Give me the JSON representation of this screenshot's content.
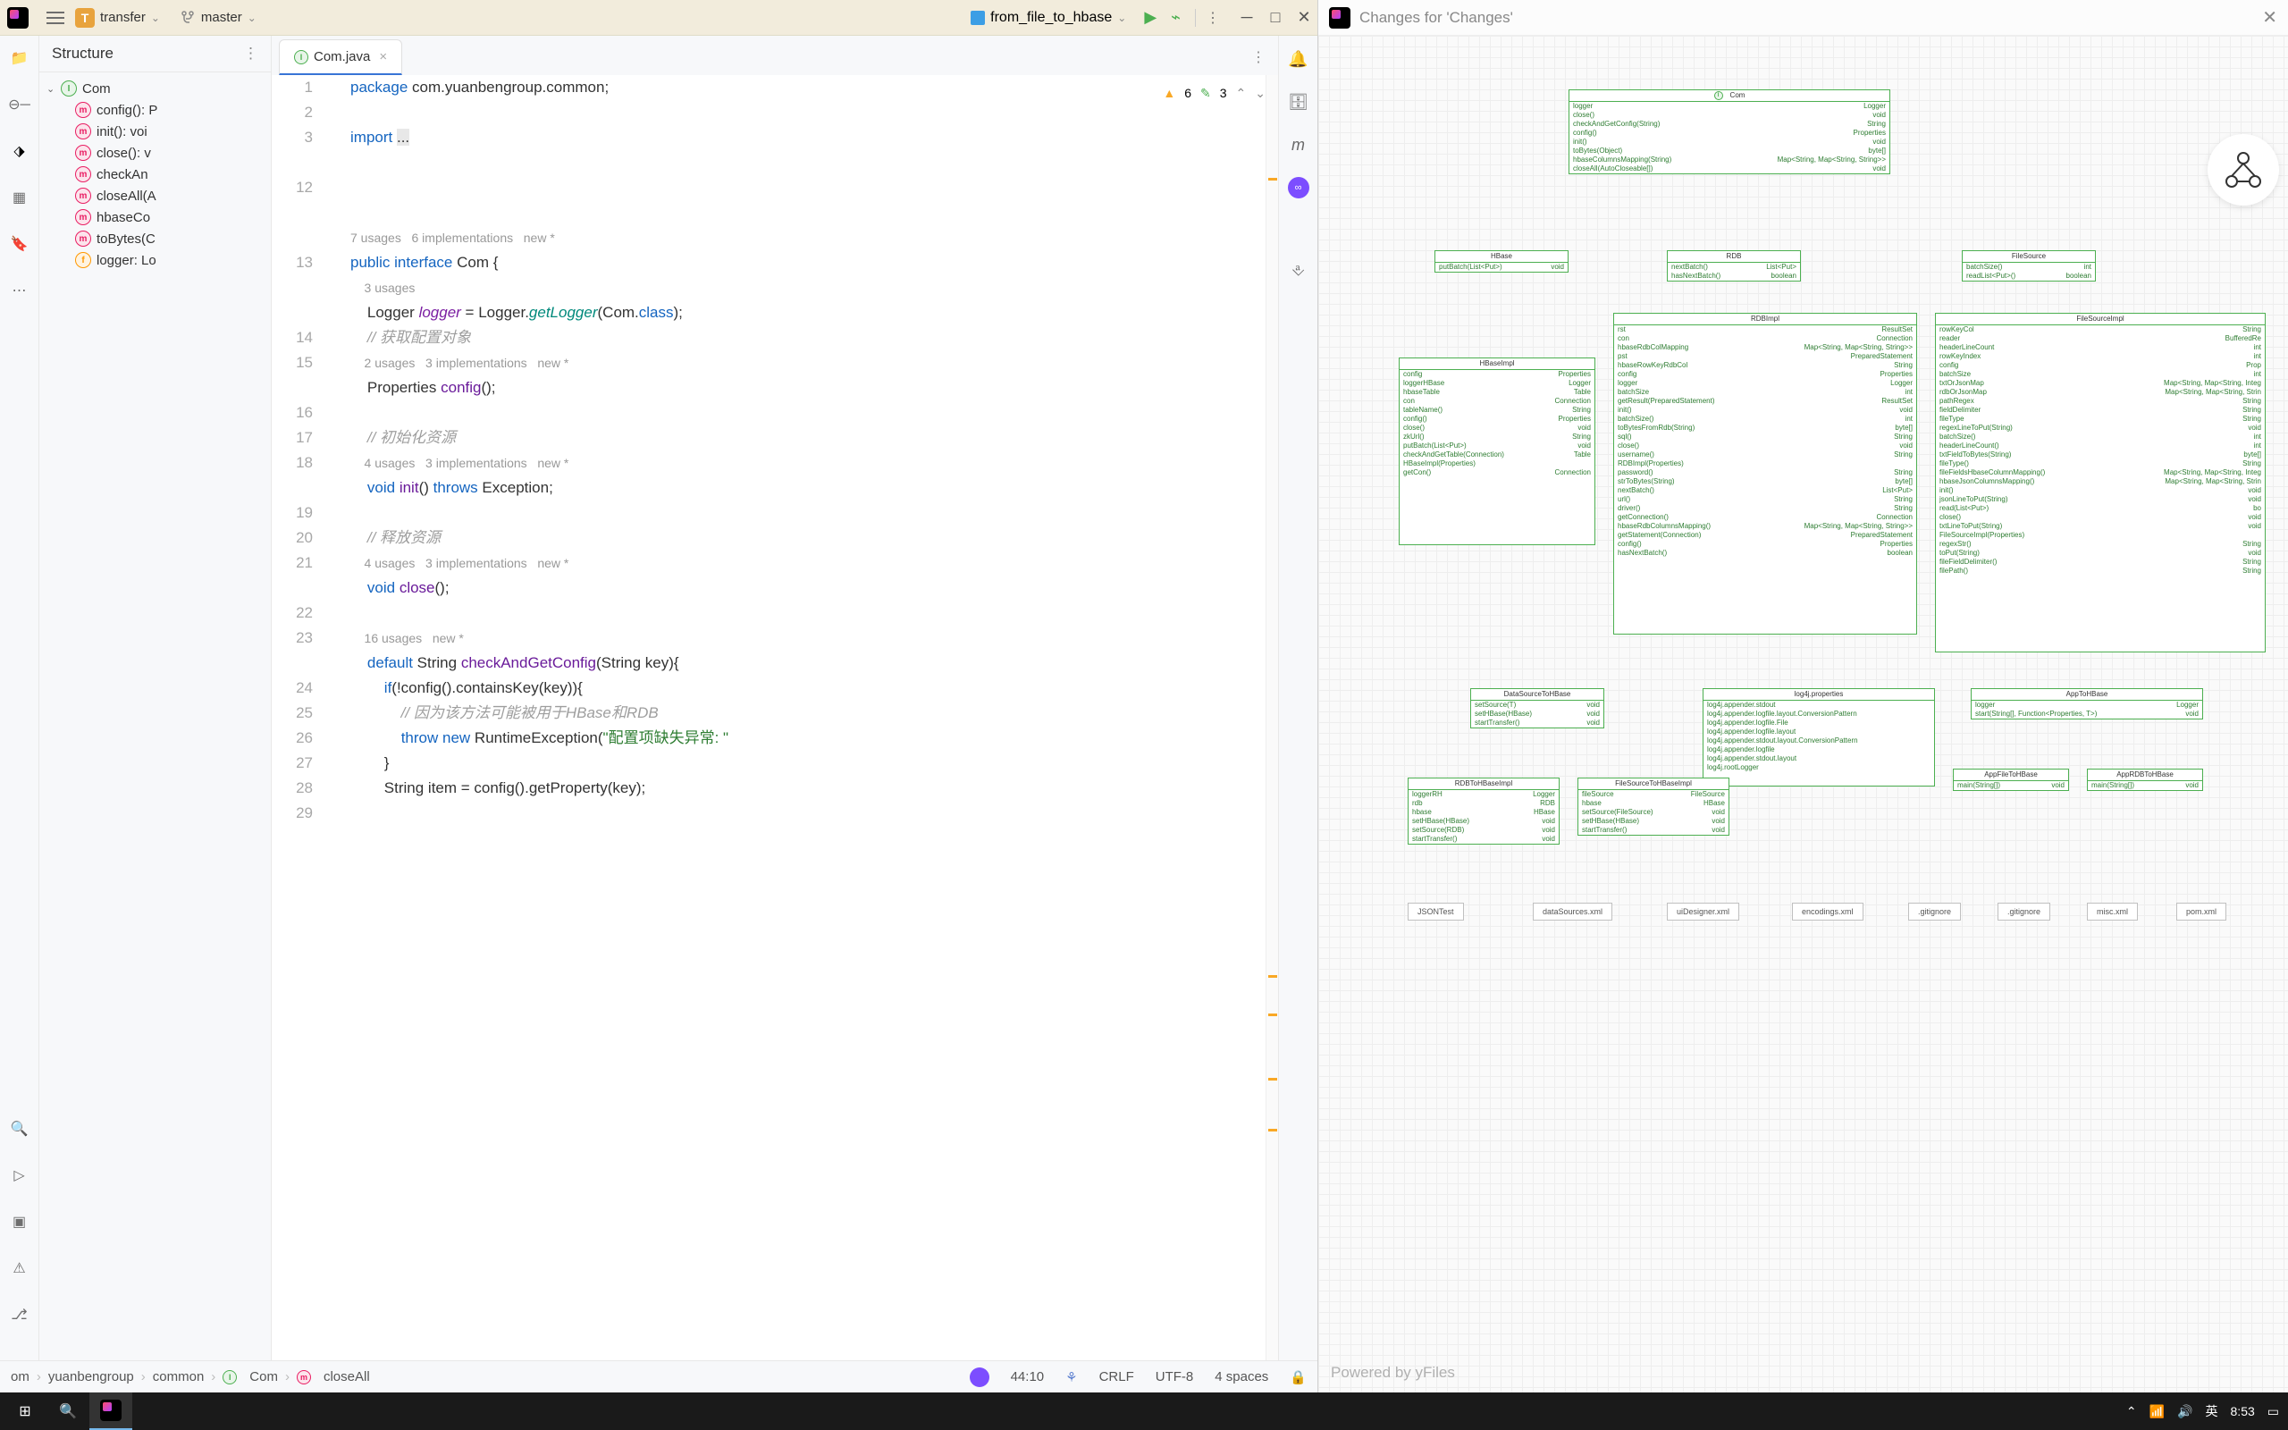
{
  "titlebar": {
    "project_badge": "T",
    "project_name": "transfer",
    "branch": "master",
    "run_config": "from_file_to_hbase"
  },
  "structure": {
    "title": "Structure",
    "root": "Com",
    "members": [
      {
        "icon": "m",
        "label": "config(): P"
      },
      {
        "icon": "m",
        "label": "init(): voi"
      },
      {
        "icon": "m",
        "label": "close(): v"
      },
      {
        "icon": "m",
        "label": "checkAn"
      },
      {
        "icon": "m",
        "label": "closeAll(A"
      },
      {
        "icon": "m",
        "label": "hbaseCo"
      },
      {
        "icon": "m",
        "label": "toBytes(C"
      },
      {
        "icon": "f",
        "label": "logger: Lo"
      }
    ]
  },
  "tab": {
    "label": "Com.java"
  },
  "inspections": {
    "warnings": "6",
    "hints": "3"
  },
  "gutter_lines": [
    "1",
    "2",
    "3",
    "",
    "12",
    "",
    "",
    "13",
    "",
    "",
    "14",
    "15",
    "",
    "16",
    "17",
    "18",
    "",
    "19",
    "20",
    "21",
    "",
    "22",
    "23",
    "",
    "24",
    "25",
    "26",
    "27",
    "28",
    "29"
  ],
  "code": {
    "l1a": "package",
    "l1b": " com.yuanbengroup.common;",
    "l3a": "import",
    "l3b": " ",
    "l3c": "...",
    "l6hint": "7 usages   6 implementations   new *",
    "l7a": "public",
    "l7b": " ",
    "l7c": "interface",
    "l7d": " Com {",
    "l8hint": "    3 usages",
    "l9a": "    Logger ",
    "l9b": "logger",
    "l9c": " = Logger.",
    "l9d": "getLogger",
    "l9e": "(Com.",
    "l9f": "class",
    "l9g": ");",
    "l10": "    // 获取配置对象",
    "l11hint": "    2 usages   3 implementations   new *",
    "l12a": "    Properties ",
    "l12b": "config",
    "l12c": "();",
    "l14": "    // 初始化资源",
    "l15hint": "    4 usages   3 implementations   new *",
    "l16a": "    ",
    "l16b": "void",
    "l16c": " ",
    "l16d": "init",
    "l16e": "() ",
    "l16f": "throws",
    "l16g": " Exception;",
    "l18": "    // 释放资源",
    "l19hint": "    4 usages   3 implementations   new *",
    "l20a": "    ",
    "l20b": "void",
    "l20c": " ",
    "l20d": "close",
    "l20e": "();",
    "l22hint": "    16 usages   new *",
    "l23a": "    ",
    "l23b": "default",
    "l23c": " String ",
    "l23d": "checkAndGetConfig",
    "l23e": "(String key){",
    "l24a": "        ",
    "l24b": "if",
    "l24c": "(!config().containsKey(key)){",
    "l25": "            // 因为该方法可能被用于HBase和RDB",
    "l26a": "            ",
    "l26b": "throw",
    "l26c": " ",
    "l26d": "new",
    "l26e": " RuntimeException(",
    "l26f": "\"配置项缺失异常: \"",
    "l27": "        }",
    "l28a": "        String item = config().getProperty(key);"
  },
  "breadcrumb": {
    "parts": [
      "om",
      "yuanbengroup",
      "common",
      "Com",
      "closeAll"
    ]
  },
  "status": {
    "pos": "44:10",
    "eol": "CRLF",
    "enc": "UTF-8",
    "indent": "4 spaces"
  },
  "diagram": {
    "title": "Changes for 'Changes'",
    "yfiles": "Powered by yFiles",
    "com": {
      "title": "Com",
      "rows": [
        [
          "logger",
          "Logger"
        ],
        [
          "close()",
          "void"
        ],
        [
          "checkAndGetConfig(String)",
          "String"
        ],
        [
          "config()",
          "Properties"
        ],
        [
          "init()",
          "void"
        ],
        [
          "toBytes(Object)",
          "byte[]"
        ],
        [
          "hbaseColumnsMapping(String)",
          "Map<String, Map<String, String>>"
        ],
        [
          "closeAll(AutoCloseable[])",
          "void"
        ]
      ]
    },
    "hbase": {
      "title": "HBase",
      "rows": [
        [
          "putBatch(List<Put>)",
          "void"
        ]
      ]
    },
    "rdb": {
      "title": "RDB",
      "rows": [
        [
          "nextBatch()",
          "List<Put>"
        ],
        [
          "hasNextBatch()",
          "boolean"
        ]
      ]
    },
    "filesource": {
      "title": "FileSource",
      "rows": [
        [
          "batchSize()",
          "int"
        ],
        [
          "readList<Put>()",
          "boolean"
        ]
      ]
    },
    "hbaseimpl_title": "HBaseImpl",
    "rdbimpl_title": "RDBImpl",
    "filesourceimpl_title": "FileSourceImpl",
    "ds2hbase_title": "DataSourceToHBase",
    "log4j_title": "log4j.properties",
    "app2hbase_title": "AppToHBase",
    "rdb2hbase_title": "RDBToHBaseImpl",
    "fs2hbase_title": "FileSourceToHBaseImpl",
    "appfile_title": "AppFileToHBase",
    "apprdb_title": "AppRDBToHBase",
    "files": [
      "JSONTest",
      "dataSources.xml",
      "uiDesigner.xml",
      "encodings.xml",
      ".gitignore",
      ".gitignore",
      "misc.xml",
      "pom.xml"
    ]
  },
  "taskbar": {
    "ime": "英",
    "time": "8:53"
  }
}
